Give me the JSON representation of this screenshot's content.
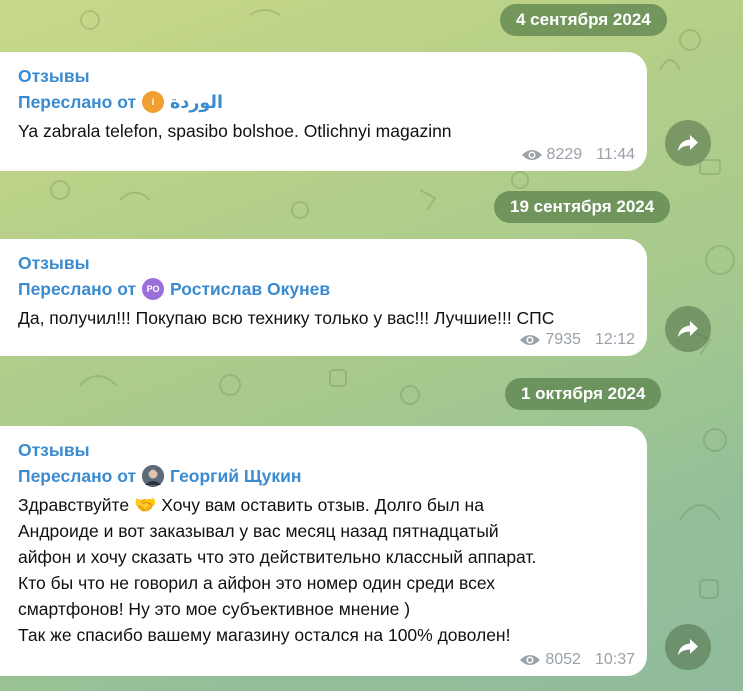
{
  "dates": [
    "4 сентября 2024",
    "19 сентября 2024",
    "1 октября 2024"
  ],
  "messages": [
    {
      "channel": "Отзывы",
      "forwarded_prefix": "Переслано от",
      "author": "الوردة",
      "avatar_initials": "I",
      "avatar_color": "#f0a030",
      "text": "Ya zabrala telefon, spasibo bolshoe. Otlichnyi magazinn",
      "views": "8229",
      "time": "11:44"
    },
    {
      "channel": "Отзывы",
      "forwarded_prefix": "Переслано от",
      "author": "Ростислав Окунев",
      "avatar_initials": "РО",
      "avatar_color": "#9b6fd8",
      "text": "Да, получил!!! Покупаю всю технику только у вас!!! Лучшие!!! СПС",
      "views": "7935",
      "time": "12:12"
    },
    {
      "channel": "Отзывы",
      "forwarded_prefix": "Переслано от",
      "author": "Георгий Щукин",
      "avatar_color": "#4a5a6a",
      "text_before_emoji": "Здравствуйте",
      "emoji": "🤝",
      "text_lines": [
        "Хочу вам оставить отзыв. Долго был на",
        "Андроиде и вот заказывал у вас месяц назад пятнадцатый",
        "айфон и хочу сказать что это действительно классный аппарат.",
        "Кто бы что не говорил а айфон это номер один среди всех",
        "смартфонов! Ну это мое субъективное мнение )",
        "Так же спасибо вашему магазину остался на 100% доволен!"
      ],
      "views": "8052",
      "time": "10:37"
    }
  ],
  "icons": {
    "views": "eye-icon",
    "share": "share-arrow-icon"
  },
  "colors": {
    "link": "#3a8bd0",
    "meta": "#9aa1a8",
    "date_pill": "#58804a"
  }
}
